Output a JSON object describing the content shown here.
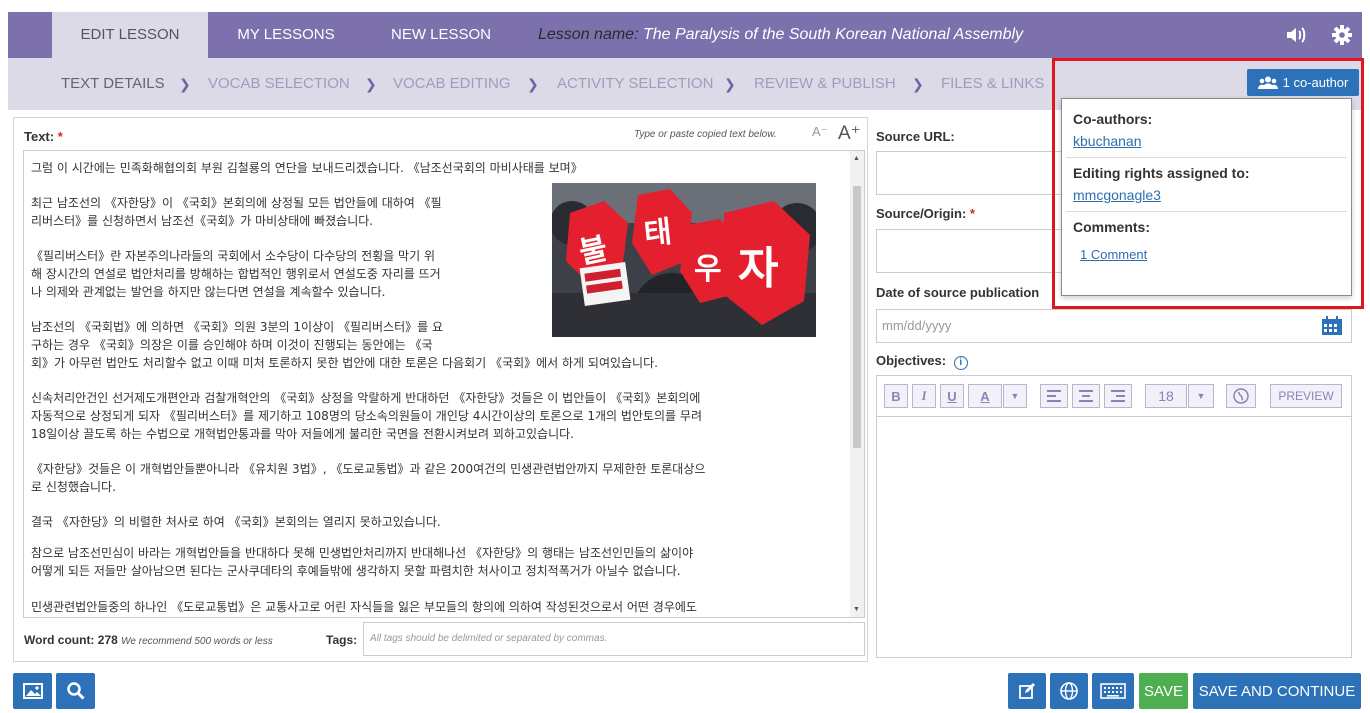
{
  "top_nav": {
    "tabs": [
      {
        "label": "EDIT LESSON",
        "active": true
      },
      {
        "label": "MY LESSONS",
        "active": false
      },
      {
        "label": "NEW LESSON",
        "active": false
      }
    ],
    "lesson_name_prefix": "Lesson name:",
    "lesson_name": "The Paralysis of the South Korean National Assembly",
    "icons": [
      "speaker-icon",
      "gear-icon"
    ]
  },
  "steps": {
    "items": [
      {
        "label": "TEXT DETAILS",
        "active": true
      },
      {
        "label": "VOCAB SELECTION",
        "active": false
      },
      {
        "label": "VOCAB EDITING",
        "active": false
      },
      {
        "label": "ACTIVITY SELECTION",
        "active": false
      },
      {
        "label": "REVIEW & PUBLISH",
        "active": false
      },
      {
        "label": "FILES & LINKS",
        "active": false
      }
    ],
    "coauthor_button": "1 co-author"
  },
  "text_panel": {
    "label": "Text:",
    "required_mark": "*",
    "hint": "Type or paste copied text below.",
    "font_decrease": "A⁻",
    "font_increase": "A⁺",
    "paragraphs": [
      [
        "그럼 이 시간에는 민족화해협의회 부원 김철룡의 연단을 보내드리겠습니다. 《남조선국회의 마비사태를 보며》"
      ],
      [
        "최근 남조선의 《자한당》이 《국회》본회의에 상정될 모든 법안들에 대하여 《필",
        "리버스터》를 신청하면서 남조선《국회》가 마비상태에 빠졌습니다."
      ],
      [
        "《필리버스터》란 자본주의나라들의 국회에서 소수당이 다수당의 전횡을 막기 위",
        "해 장시간의 연설로 법안처리를 방해하는 합법적인 행위로서 연설도중 자리를 뜨거",
        "나 의제와 관계없는 발언을 하지만 않는다면 연설을 계속할수 있습니다."
      ],
      [
        "남조선의 《국회법》에 의하면 《국회》의원 3분의 1이상이 《필리버스터》를 요",
        "구하는 경우 《국회》의장은 이를 승인해야 하며 이것이 진행되는 동안에는 《국",
        "회》가 아무런 법안도 처리할수 없고 이때 미처 토론하지 못한 법안에 대한 토론은 다음회기 《국회》에서 하게 되여있습니다."
      ],
      [
        "신속처리안건인 선거제도개편안과 검찰개혁안의 《국회》상정을 악랄하게 반대하던 《자한당》것들은 이 법안들이 《국회》본회의에",
        "자동적으로 상정되게 되자 《필리버스터》를 제기하고 108명의 당소속의원들이 개인당 4시간이상의 토론으로 1개의 법안토의를 무려",
        "18일이상 끌도록 하는 수법으로 개혁법안통과를 막아 저들에게 불리한 국면을 전환시켜보려 꾀하고있습니다."
      ],
      [
        "《자한당》것들은 이 개혁법안들뿐아니라 《유치원 3법》, 《도로교통법》과 같은 200여건의 민생관련법안까지 무제한한 토론대상으",
        "로 신청했습니다."
      ],
      [
        "결국 《자한당》의 비렬한 처사로 하여 《국회》본회의는 열리지 못하고있습니다."
      ],
      [
        "참으로 남조선민심이 바라는 개혁법안들을 반대하다 못해 민생법안처리까지 반대해나선 《자한당》의 행태는 남조선인민들의 삶이야",
        "어떻게 되든 저들만 살아남으면 된다는 군사쿠데타의 후예들밖에 생각하지 못할 파렴치한 처사이고 정치적폭거가 아닐수 없습니다."
      ],
      [
        "민생관련법안들중의 하나인 《도로교통법》은 교통사고로 어린 자식들을 잃은 부모들의 항의에 의하여 작성된것으로서 어떤 경우에도"
      ]
    ],
    "word_count_label": "Word count:",
    "word_count": "278",
    "word_count_note": "We recommend 500 words or less",
    "tags_label": "Tags:",
    "tags_placeholder": "All tags should be delimited or separated by commas."
  },
  "right_panel": {
    "source_url_label": "Source URL:",
    "source_origin_label": "Source/Origin:",
    "required_mark": "*",
    "date_label": "Date of source publication",
    "date_placeholder": "mm/dd/yyyy",
    "objectives_label": "Objectives:",
    "toolbar": {
      "bold": "B",
      "italic": "I",
      "underline": "U",
      "color": "A",
      "font_size": "18",
      "preview": "PREVIEW"
    }
  },
  "popup": {
    "coauthors_heading": "Co-authors:",
    "coauthor": "kbuchanan",
    "rights_heading": "Editing rights assigned to:",
    "rights_user": "mmcgonagle3",
    "comments_heading": "Comments:",
    "comments_link": "1 Comment"
  },
  "bottom_bar": {
    "save": "SAVE",
    "save_continue": "SAVE AND CONTINUE"
  },
  "colors": {
    "nav": "#7d71ad",
    "subnav": "#dcdae7",
    "primary": "#2d72b8",
    "save": "#4fae4f",
    "highlight": "#e0161e"
  }
}
